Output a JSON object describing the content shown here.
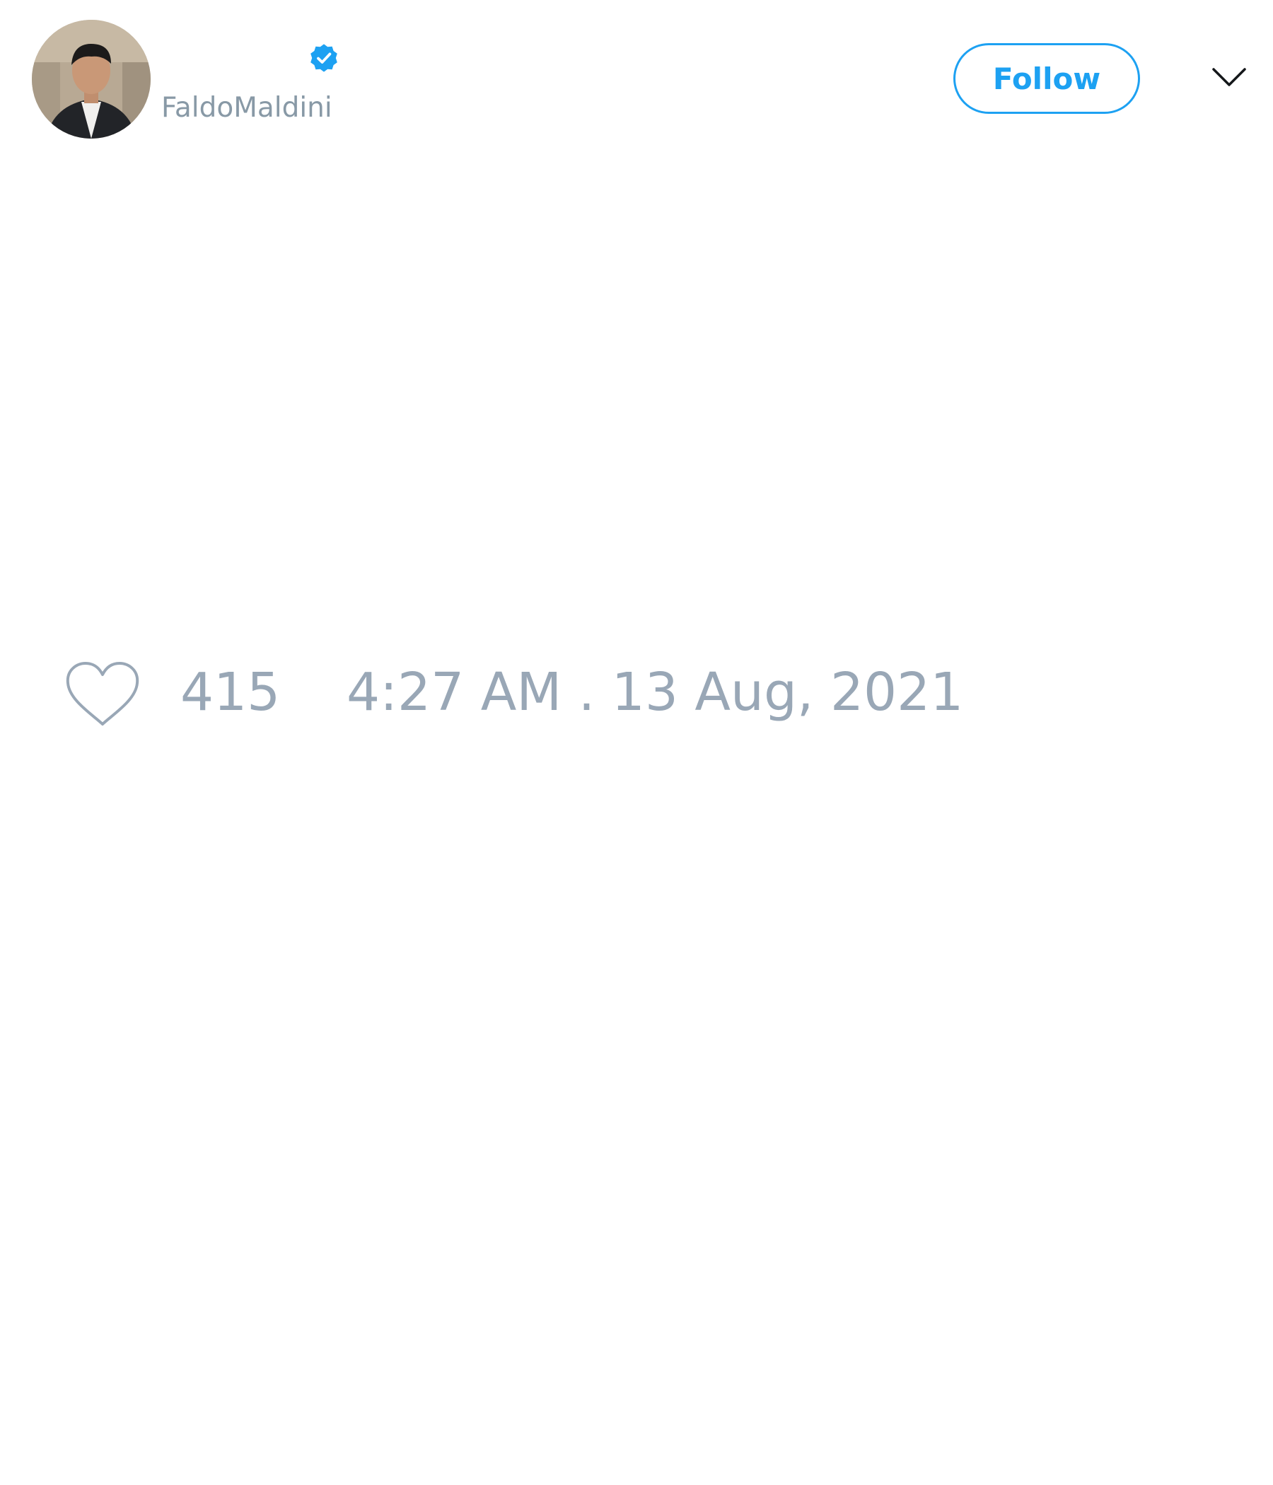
{
  "tweet": {
    "author": {
      "display_name": "",
      "username": "FaldoMaldini",
      "verified": true
    },
    "follow_label": "Follow",
    "likes": "415",
    "timestamp": "4:27 AM . 13 Aug, 2021"
  },
  "icons": {
    "verified": "verified-badge-icon",
    "menu": "chevron-down-icon",
    "like": "heart-outline-icon"
  },
  "colors": {
    "accent": "#1da1f2",
    "muted_text": "#8899a6",
    "background": "#ffffff"
  }
}
